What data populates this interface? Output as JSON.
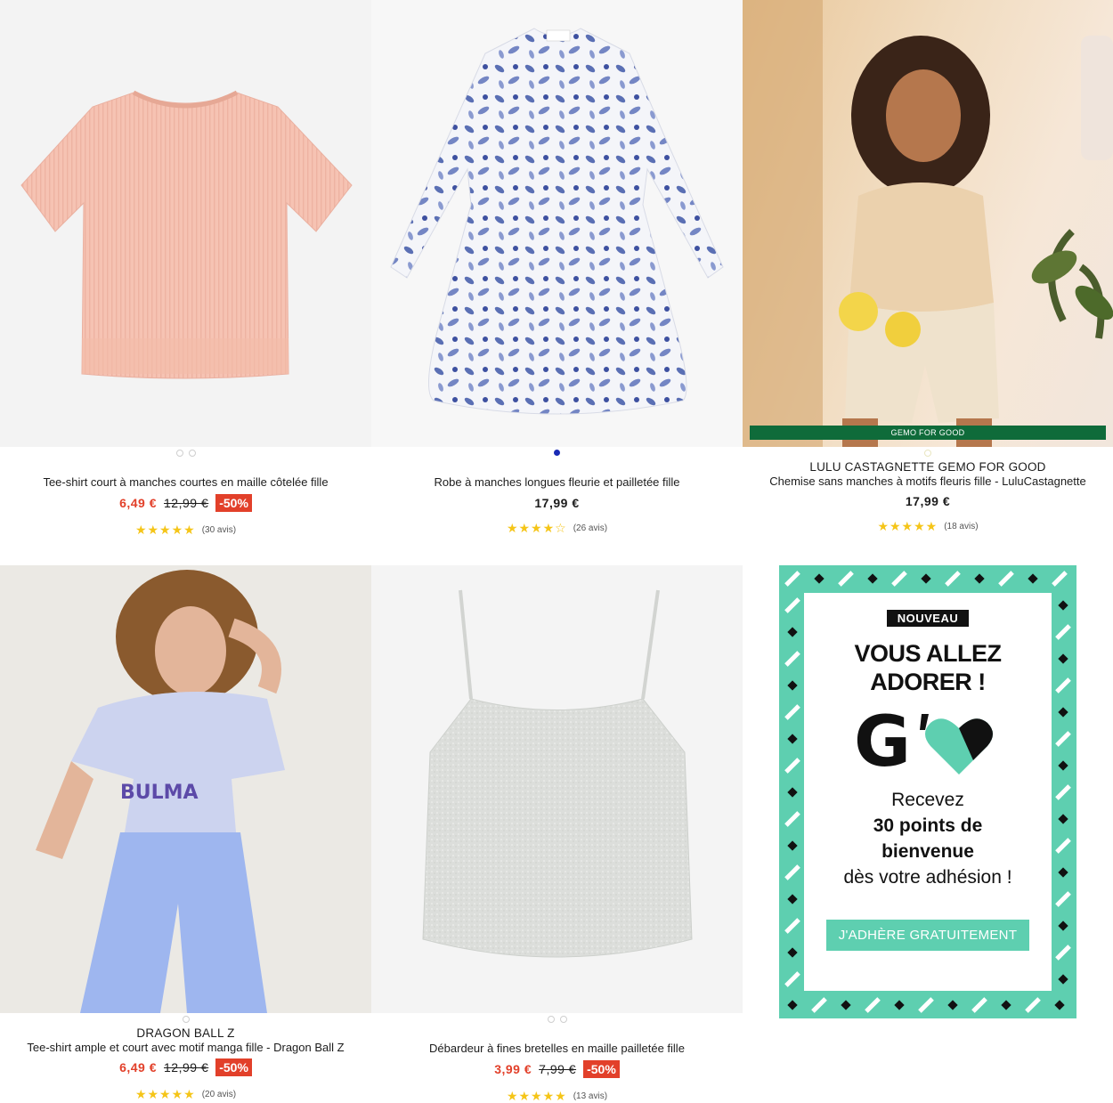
{
  "products": [
    {
      "title": "Tee-shirt court à manches courtes en maille côtelée fille",
      "price": "6,49 €",
      "old_price": "12,99 €",
      "discount": "-50%",
      "rating": 5,
      "reviews": "(30 avis)"
    },
    {
      "title": "Robe à manches longues fleurie et pailletée fille",
      "price": "17,99 €",
      "rating": 4.5,
      "reviews": "(26 avis)"
    },
    {
      "brand": "LULU CASTAGNETTE GEMO FOR GOOD",
      "title": "Chemise sans manches à motifs fleuris fille - LuluCastagnette",
      "price": "17,99 €",
      "rating": 5,
      "reviews": "(18 avis)",
      "banner": "GEMO FOR GOOD"
    },
    {
      "brand": "DRAGON BALL Z",
      "title": "Tee-shirt ample et court avec motif manga fille - Dragon Ball Z",
      "price": "6,49 €",
      "old_price": "12,99 €",
      "discount": "-50%",
      "rating": 5,
      "reviews": "(20 avis)",
      "tshirt_print": "BULMA"
    },
    {
      "title": "Débardeur à fines bretelles en maille pailletée fille",
      "price": "3,99 €",
      "old_price": "7,99 €",
      "discount": "-50%",
      "rating": 5,
      "reviews": "(13 avis)"
    }
  ],
  "promo": {
    "badge": "NOUVEAU",
    "headline_1": "VOUS ALLEZ",
    "headline_2": "ADORER !",
    "logo_letter": "G",
    "text_1": "Recevez",
    "text_2a": "30 points de",
    "text_2b": "bienvenue",
    "text_3": "dès votre adhésion !",
    "button": "J'ADHÈRE GRATUITEMENT"
  },
  "stars": {
    "five": "★★★★★",
    "four_half": "★★★★☆"
  },
  "colors": {
    "sale": "#e2402a",
    "accent_blue": "#1a2bb5",
    "star": "#f5c518",
    "gemo_green": "#0f6b3a",
    "promo_teal": "#5ecfb0"
  }
}
